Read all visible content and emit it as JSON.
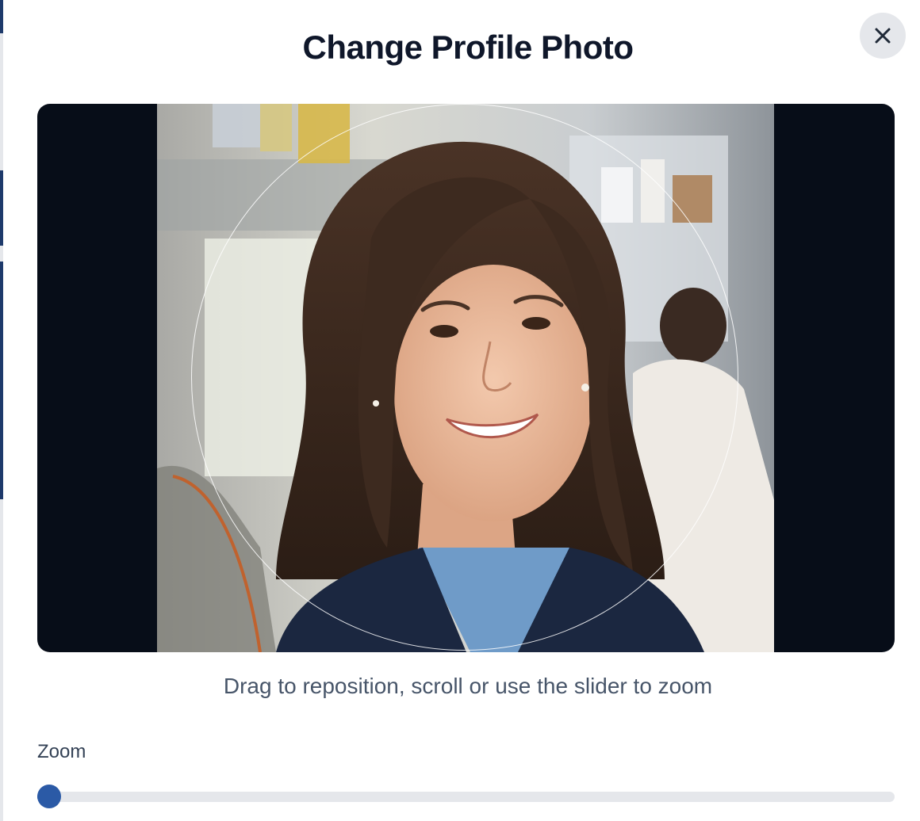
{
  "dialog": {
    "title": "Change Profile Photo",
    "close_icon": "close-icon",
    "hint": "Drag to reposition, scroll or use the slider to zoom"
  },
  "zoom": {
    "label": "Zoom",
    "value": 0
  },
  "colors": {
    "accent": "#2b5aa6",
    "title": "#0f172a",
    "crop_background": "#070d18"
  }
}
